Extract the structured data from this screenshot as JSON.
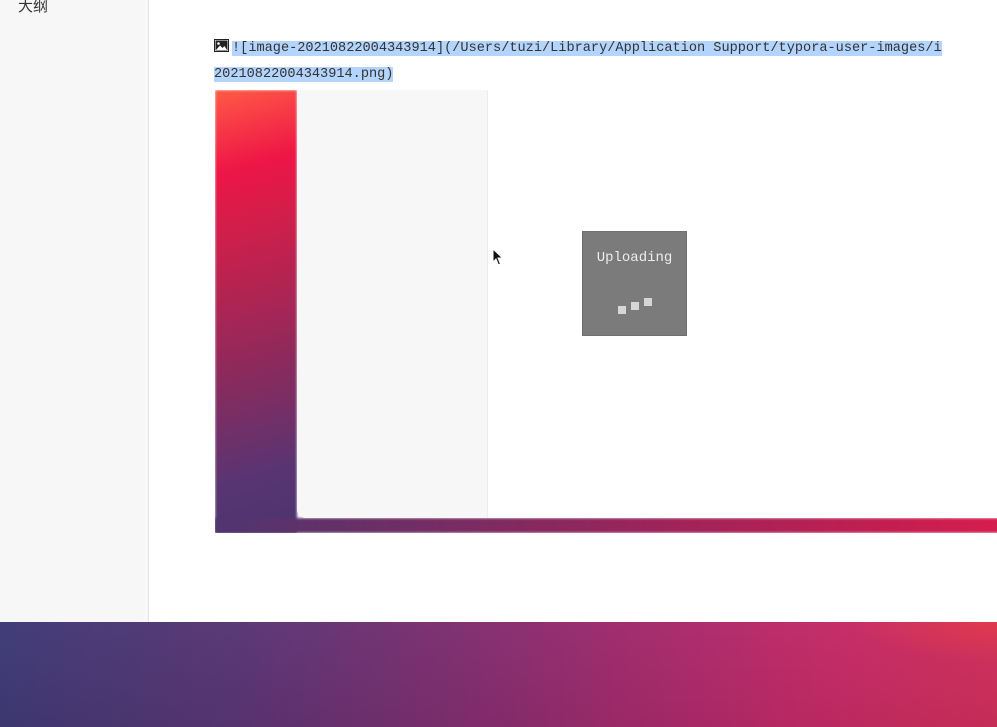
{
  "sidebar": {
    "outline_label": "大纲"
  },
  "editor": {
    "markdown_line_1": "![image-20210822004343914](/Users/tuzi/Library/Application Support/typora-user-images/i",
    "markdown_line_2": "20210822004343914.png)"
  },
  "upload_overlay": {
    "label": "Uploading"
  },
  "icons": {
    "image": "image-icon",
    "cursor": "mouse-pointer-icon",
    "loading": "loading-dots-icon"
  },
  "colors": {
    "selection": "#b3d4fc",
    "overlay": "#7b7b7b",
    "sidebar_bg": "#f7f7f7",
    "gradient_red": "#ee1646",
    "gradient_purple": "#4a3470"
  }
}
